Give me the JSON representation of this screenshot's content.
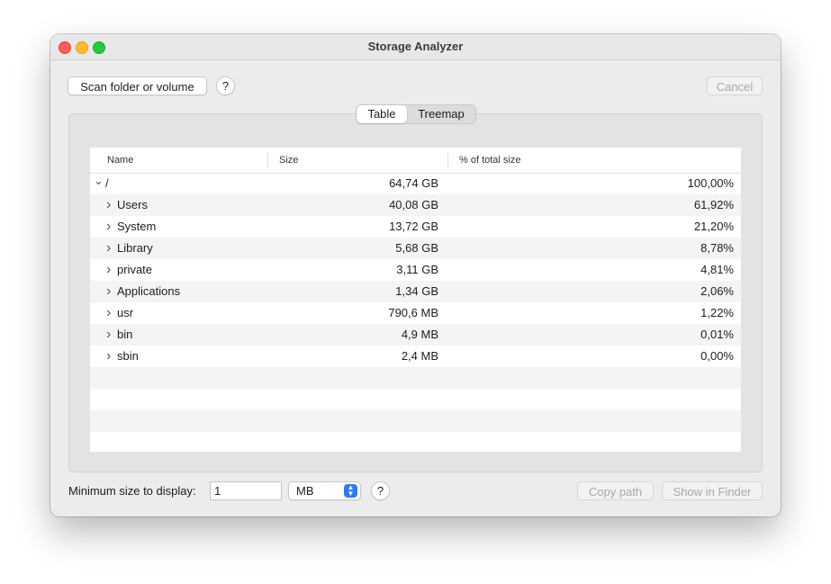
{
  "window": {
    "title": "Storage Analyzer"
  },
  "toolbar": {
    "scan_label": "Scan folder or volume",
    "help_label": "?",
    "cancel_label": "Cancel"
  },
  "view_tabs": [
    {
      "label": "Table",
      "selected": true
    },
    {
      "label": "Treemap",
      "selected": false
    }
  ],
  "table": {
    "columns": [
      "Name",
      "Size",
      "% of total size"
    ],
    "rows": [
      {
        "disclosure": "expanded",
        "name": "/",
        "size": "64,74 GB",
        "percent": "100,00%"
      },
      {
        "disclosure": "collapsed",
        "name": "Users",
        "size": "40,08 GB",
        "percent": "61,92%"
      },
      {
        "disclosure": "collapsed",
        "name": "System",
        "size": "13,72 GB",
        "percent": "21,20%"
      },
      {
        "disclosure": "collapsed",
        "name": "Library",
        "size": "5,68 GB",
        "percent": "8,78%"
      },
      {
        "disclosure": "collapsed",
        "name": "private",
        "size": "3,11 GB",
        "percent": "4,81%"
      },
      {
        "disclosure": "collapsed",
        "name": "Applications",
        "size": "1,34 GB",
        "percent": "2,06%"
      },
      {
        "disclosure": "collapsed",
        "name": "usr",
        "size": "790,6 MB",
        "percent": "1,22%"
      },
      {
        "disclosure": "collapsed",
        "name": "bin",
        "size": "4,9 MB",
        "percent": "0,01%"
      },
      {
        "disclosure": "collapsed",
        "name": "sbin",
        "size": "2,4 MB",
        "percent": "0,00%"
      }
    ]
  },
  "footer": {
    "min_size_label": "Minimum size to display:",
    "min_size_value": "1",
    "unit_selected": "MB",
    "help_label": "?",
    "copy_path_label": "Copy path",
    "show_in_finder_label": "Show in Finder"
  },
  "icons": {
    "expanded": "chevron-down-icon",
    "collapsed": "chevron-right-icon",
    "select": "updown-chevron-icon"
  },
  "colors": {
    "accent": "#2f7bf5",
    "close": "#fe5f57",
    "minimize": "#febc2e",
    "zoom": "#28c840"
  }
}
